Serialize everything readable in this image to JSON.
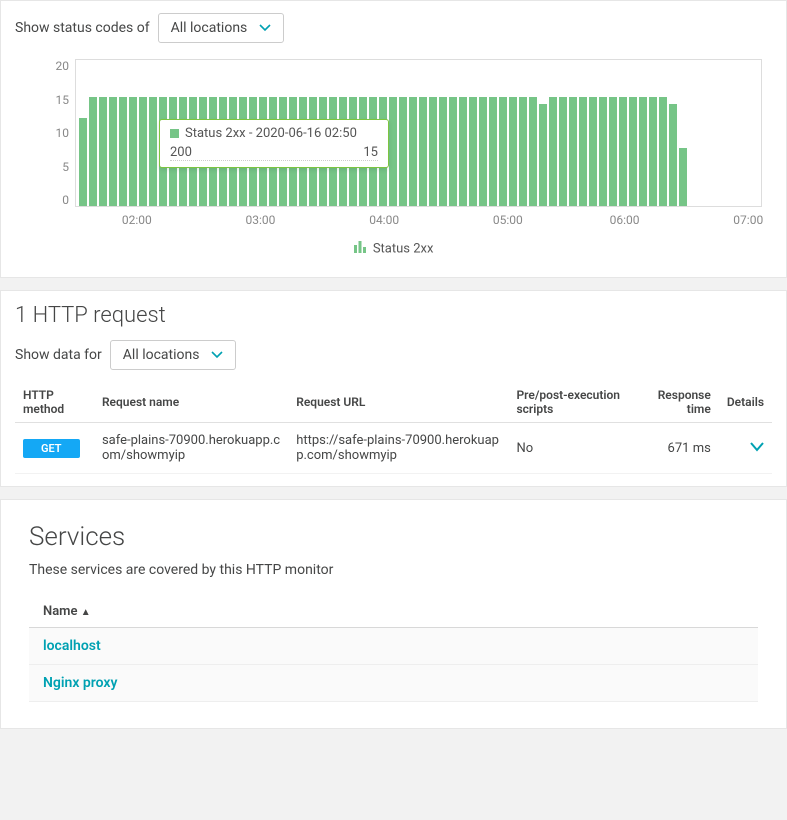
{
  "status_codes": {
    "label": "Show status codes of",
    "selector": {
      "selected": "All locations"
    }
  },
  "chart_data": {
    "type": "bar",
    "title": "",
    "xlabel": "",
    "ylabel": "",
    "ylim": [
      0,
      20
    ],
    "y_ticks": [
      20,
      15,
      10,
      5,
      0
    ],
    "x_ticks": [
      {
        "label": "02:00",
        "pct": 9
      },
      {
        "label": "03:00",
        "pct": 27
      },
      {
        "label": "04:00",
        "pct": 45
      },
      {
        "label": "05:00",
        "pct": 63
      },
      {
        "label": "06:00",
        "pct": 80
      },
      {
        "label": "07:00",
        "pct": 98
      }
    ],
    "categories_count": 62,
    "series": [
      {
        "name": "Status 2xx",
        "values": [
          12,
          15,
          15,
          15,
          15,
          15,
          15,
          15,
          15,
          15,
          15,
          15,
          15,
          15,
          15,
          15,
          15,
          15,
          15,
          15,
          15,
          15,
          15,
          15,
          15,
          15,
          15,
          15,
          15,
          15,
          15,
          15,
          15,
          15,
          15,
          15,
          15,
          15,
          15,
          15,
          15,
          15,
          15,
          15,
          15,
          15,
          14,
          15,
          15,
          15,
          15,
          15,
          15,
          15,
          15,
          15,
          15,
          15,
          15,
          14,
          8,
          0
        ]
      }
    ],
    "legend": "Status 2xx"
  },
  "tooltip": {
    "header": "Status 2xx - 2020-06-16 02:50",
    "code": "200",
    "value": "15"
  },
  "http": {
    "title": "1 HTTP request",
    "filter_label": "Show data for",
    "filter_selected": "All locations",
    "columns": {
      "method": "HTTP method",
      "name": "Request name",
      "url": "Request URL",
      "scripts": "Pre/post-execution scripts",
      "time": "Response time",
      "details": "Details"
    },
    "rows": [
      {
        "method": "GET",
        "name": "safe-plains-70900.herokuapp.com/showmyip",
        "url": "https://safe-plains-70900.herokuapp.com/showmyip",
        "scripts": "No",
        "time": "671 ms"
      }
    ]
  },
  "services": {
    "title": "Services",
    "subtitle": "These services are covered by this HTTP monitor",
    "name_col": "Name",
    "rows": [
      {
        "name": "localhost"
      },
      {
        "name": "Nginx proxy"
      }
    ]
  }
}
